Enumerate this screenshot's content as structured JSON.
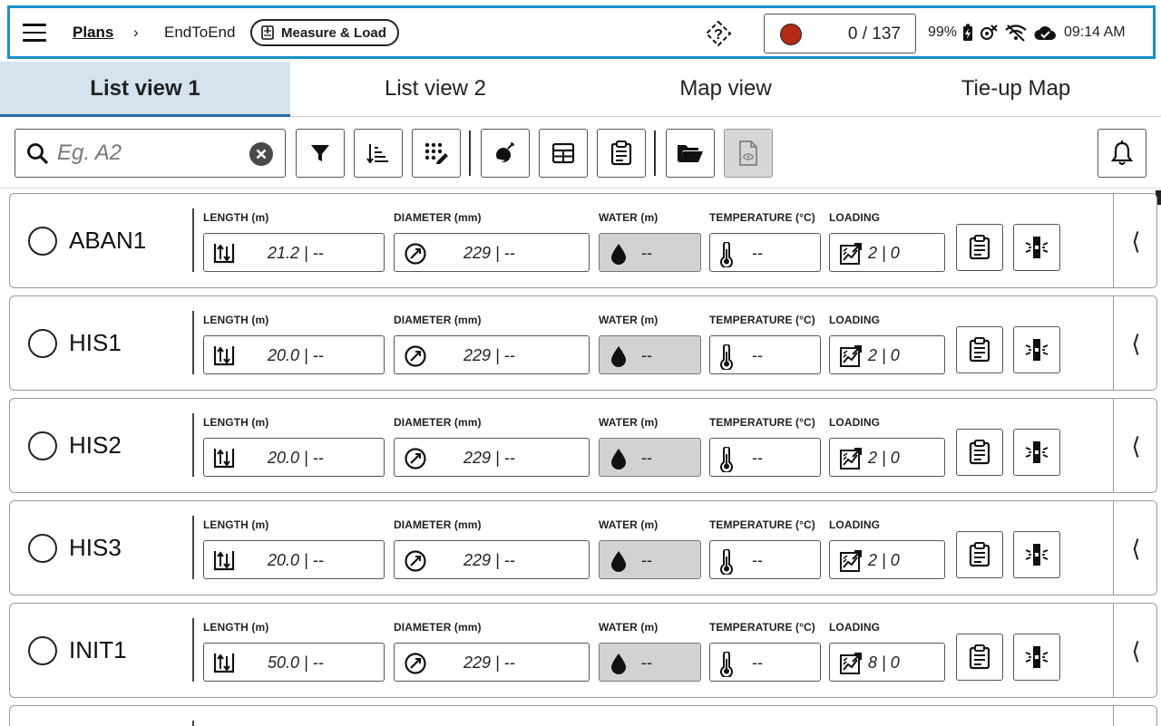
{
  "header": {
    "breadcrumb_root": "Plans",
    "breadcrumb_sep": "›",
    "breadcrumb_current": "EndToEnd",
    "mode_label": "Measure & Load",
    "progress": "0 / 137",
    "battery": "99%",
    "time": "09:14 AM",
    "record_color": "#b52a16",
    "accent_border": "#1a8fc9"
  },
  "tabs": [
    {
      "label": "List view 1",
      "active": true
    },
    {
      "label": "List view 2",
      "active": false
    },
    {
      "label": "Map view",
      "active": false
    },
    {
      "label": "Tie-up Map",
      "active": false
    }
  ],
  "toolbar": {
    "search_placeholder": "Eg. A2",
    "buttons": [
      "filter-icon",
      "sort-icon",
      "edit-pattern-icon",
      "blast-icon",
      "table-icon",
      "clipboard-icon",
      "folder-open-icon",
      "document-view-icon",
      "bell-icon"
    ]
  },
  "labels": {
    "length": "LENGTH (m)",
    "diameter": "DIAMETER (mm)",
    "water": "WATER (m)",
    "temperature": "TEMPERATURE (°C)",
    "loading": "LOADING"
  },
  "rows": [
    {
      "name": "ABAN1",
      "length": "21.2 | --",
      "diameter": "229 | --",
      "water": "--",
      "temperature": "--",
      "loading": "2 | 0"
    },
    {
      "name": "HIS1",
      "length": "20.0 | --",
      "diameter": "229 | --",
      "water": "--",
      "temperature": "--",
      "loading": "2 | 0"
    },
    {
      "name": "HIS2",
      "length": "20.0 | --",
      "diameter": "229 | --",
      "water": "--",
      "temperature": "--",
      "loading": "2 | 0"
    },
    {
      "name": "HIS3",
      "length": "20.0 | --",
      "diameter": "229 | --",
      "water": "--",
      "temperature": "--",
      "loading": "2 | 0"
    },
    {
      "name": "INIT1",
      "length": "50.0 | --",
      "diameter": "229 | --",
      "water": "--",
      "temperature": "--",
      "loading": "8 | 0"
    }
  ]
}
